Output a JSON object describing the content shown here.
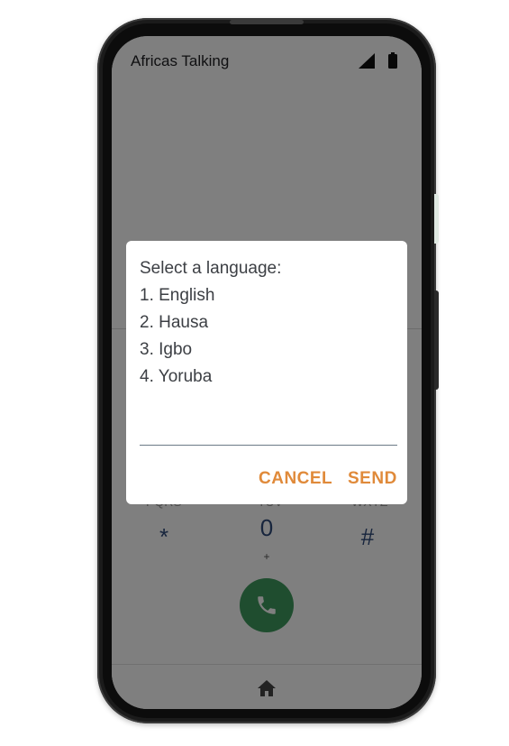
{
  "status_bar": {
    "carrier": "Africas Talking",
    "icons": [
      "signal-icon",
      "battery-icon"
    ]
  },
  "dialpad": {
    "star": "*",
    "zero": "0",
    "zero_sub": "+",
    "hash": "#"
  },
  "dialog": {
    "lines": [
      "Select a language:",
      "1. English",
      "2. Hausa",
      "3. Igbo",
      "4. Yoruba"
    ],
    "input_value": "",
    "cancel_label": "CANCEL",
    "send_label": "SEND"
  },
  "colors": {
    "accent": "#e08a3a",
    "call_button": "#3f9a5e",
    "scrim": "rgba(0,0,0,0.5)"
  }
}
